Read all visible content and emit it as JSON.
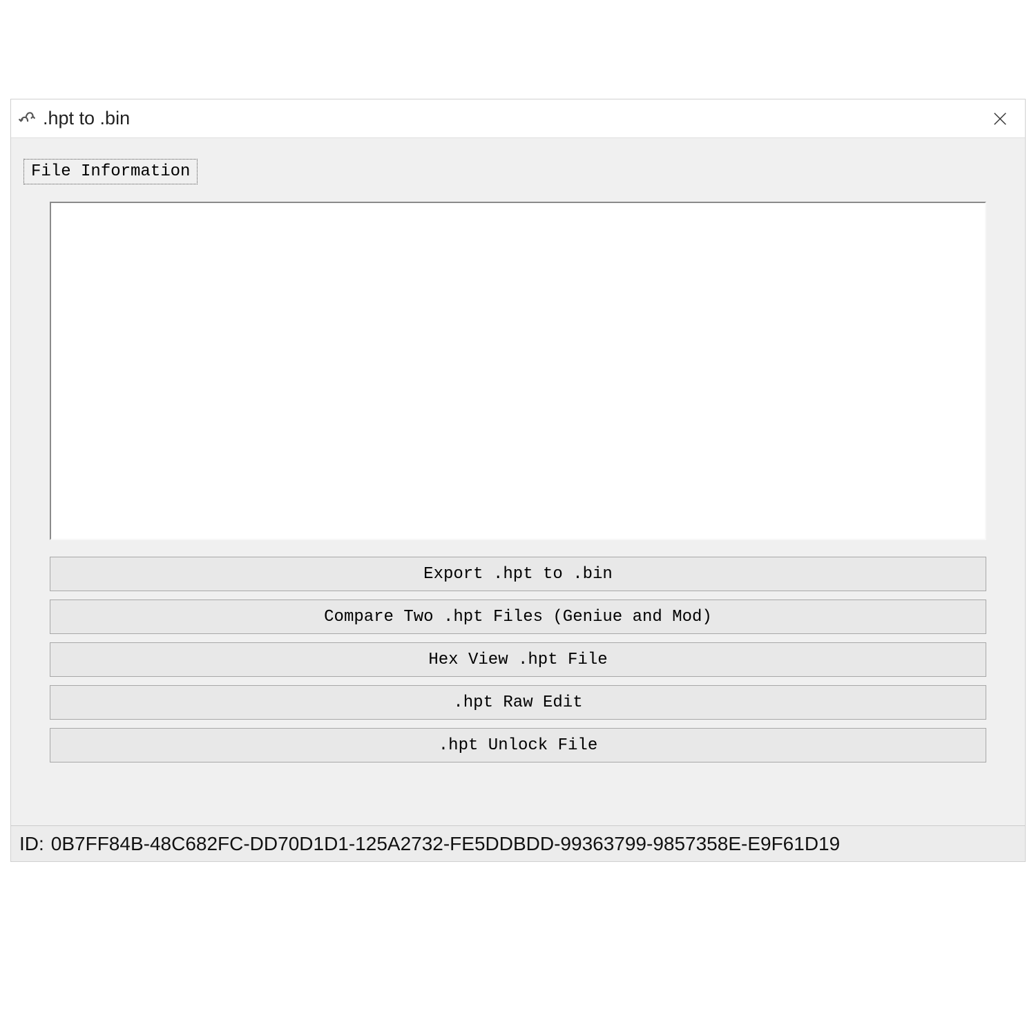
{
  "window": {
    "title": ".hpt to .bin"
  },
  "tab": {
    "label": "File Information"
  },
  "buttons": {
    "export": "Export .hpt to .bin",
    "compare": "Compare Two .hpt Files (Geniue and Mod)",
    "hexview": "Hex View .hpt File",
    "rawedit": ".hpt Raw Edit",
    "unlock": ".hpt Unlock File"
  },
  "status": {
    "id_label": "ID:",
    "id_value": "0B7FF84B-48C682FC-DD70D1D1-125A2732-FE5DDBDD-99363799-9857358E-E9F61D19"
  }
}
